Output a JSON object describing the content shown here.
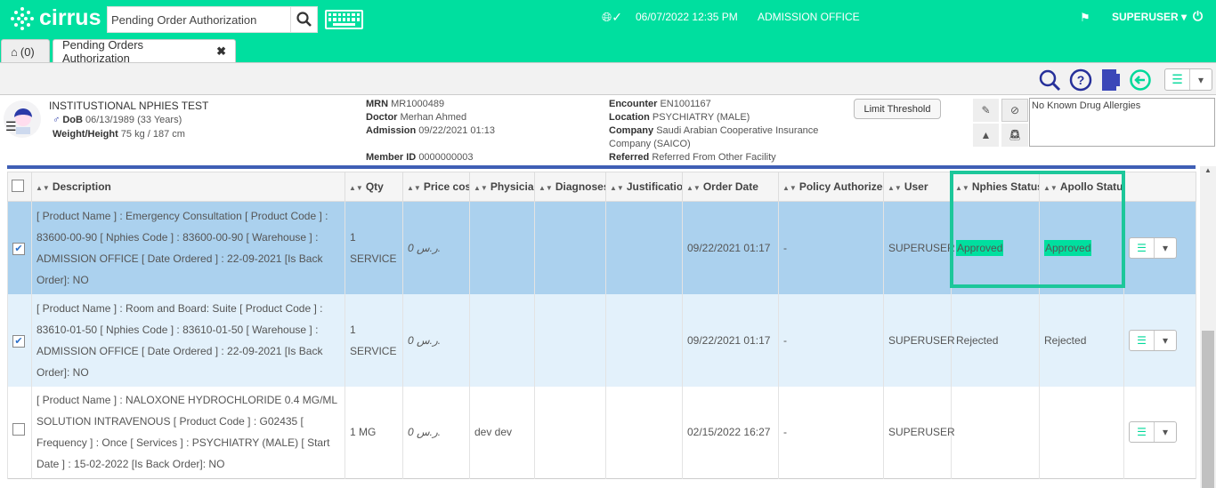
{
  "header": {
    "brand": "cirrus",
    "search_value": "Pending Order Authorization",
    "datetime": "06/07/2022 12:35 PM",
    "location": "ADMISSION OFFICE",
    "user": "SUPERUSER",
    "brand_color": "#00df9f"
  },
  "tabs": [
    {
      "label": "(0)",
      "icon": "home-icon"
    },
    {
      "label": "Pending Orders Authorization",
      "icon": "close-icon"
    }
  ],
  "patient": {
    "name": "INSTITUSTIONAL NPHIES TEST",
    "dob_label": "DoB",
    "dob": "06/13/1989 (33 Years)",
    "wh_label": "Weight/Height",
    "wh": "75 kg / 187 cm",
    "mrn_label": "MRN",
    "mrn": "MR1000489",
    "doctor_label": "Doctor",
    "doctor": "Merhan Ahmed",
    "admission_label": "Admission",
    "admission": "09/22/2021 01:13",
    "member_label": "Member ID",
    "member": "0000000003",
    "encounter_label": "Encounter",
    "encounter": "EN1001167",
    "location_label": "Location",
    "location": "PSYCHIATRY (MALE)",
    "company_label": "Company",
    "company": "Saudi Arabian Cooperative Insurance Company (SAICO)",
    "referred_label": "Referred",
    "referred": "Referred From Other Facility",
    "limit_button": "Limit Threshold",
    "allergies": "No Known Drug Allergies"
  },
  "table": {
    "columns": [
      "Description",
      "Qty",
      "Price cost",
      "Physician",
      "Diagnoses",
      "Justification",
      "Order Date",
      "Policy Authorized",
      "User",
      "Nphies Status",
      "Apollo Status"
    ],
    "rows": [
      {
        "checked": true,
        "description": "[ Product Name ] : Emergency Consultation [ Product Code ] : 83600-00-90 [ Nphies Code ] : 83600-00-90 [ Warehouse ] : ADMISSION OFFICE [ Date Ordered ] : 22-09-2021 [Is Back Order]: NO",
        "qty": "1 SERVICE",
        "price": "0 ر.س.",
        "physician": "",
        "diagnoses": "",
        "justification": "",
        "order_date": "09/22/2021 01:17",
        "policy": "-",
        "user": "SUPERUSER",
        "nphies": "Approved",
        "apollo": "Approved"
      },
      {
        "checked": true,
        "description": "[ Product Name ] : Room and Board: Suite [ Product Code ] : 83610-01-50 [ Nphies Code ] : 83610-01-50 [ Warehouse ] : ADMISSION OFFICE [ Date Ordered ] : 22-09-2021 [Is Back Order]: NO",
        "qty": "1 SERVICE",
        "price": "0 ر.س.",
        "physician": "",
        "diagnoses": "",
        "justification": "",
        "order_date": "09/22/2021 01:17",
        "policy": "-",
        "user": "SUPERUSER",
        "nphies": "Rejected",
        "apollo": "Rejected"
      },
      {
        "checked": false,
        "description": "[ Product Name ] : NALOXONE HYDROCHLORIDE 0.4 MG/ML SOLUTION INTRAVENOUS [ Product Code ] : G02435 [ Frequency ] : Once [ Services ] : PSYCHIATRY (MALE) [ Start Date ] : 15-02-2022 [Is Back Order]: NO",
        "qty": "1 MG",
        "price": "0 ر.س.",
        "physician": "dev dev",
        "diagnoses": "",
        "justification": "",
        "order_date": "02/15/2022 16:27",
        "policy": "-",
        "user": "SUPERUSER",
        "nphies": "",
        "apollo": ""
      }
    ]
  }
}
